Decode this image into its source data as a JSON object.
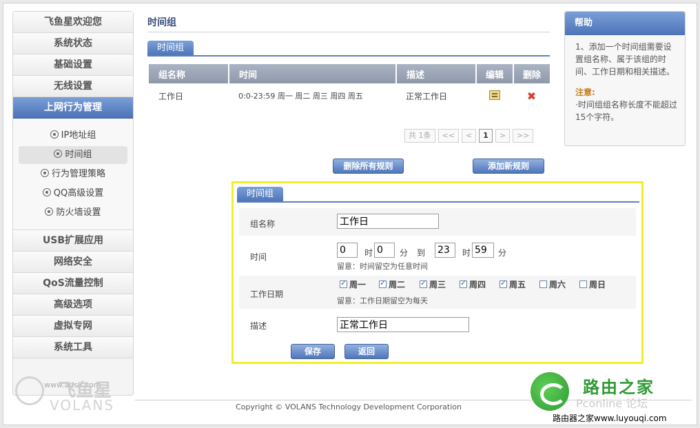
{
  "sidebar": {
    "items_top": [
      "飞鱼星欢迎您",
      "系统状态",
      "基础设置",
      "无线设置",
      "上网行为管理"
    ],
    "sub_items": [
      "IP地址组",
      "时间组",
      "行为管理策略",
      "QQ高级设置",
      "防火墙设置"
    ],
    "items_bottom": [
      "USB扩展应用",
      "网络安全",
      "QoS流量控制",
      "高级选项",
      "虚拟专网",
      "系统工具"
    ],
    "brand": {
      "zh": "飞鱼星",
      "en": "VOLANS",
      "url": "www.adslr.com"
    }
  },
  "page": {
    "title": "时间组",
    "list_tab": "时间组"
  },
  "table": {
    "headers": [
      "组名称",
      "时间",
      "描述",
      "编辑",
      "删除"
    ],
    "rows": [
      {
        "name": "工作日",
        "time": "0:0-23:59 周一 周二 周三 周四 周五",
        "desc": "正常工作日"
      }
    ],
    "icons": {
      "edit": "edit-icon",
      "delete": "delete-icon"
    }
  },
  "pager": {
    "total": "共 1条",
    "first": "<<",
    "prev": "<",
    "current": "1",
    "next": ">",
    "last": ">>"
  },
  "actions": {
    "delete_all": "删除所有规则",
    "add_new": "添加新规则"
  },
  "form": {
    "tab": "时间组",
    "name_label": "组名称",
    "name_value": "工作日",
    "time_label": "时间",
    "start_hour": "0",
    "start_min": "0",
    "end_hour": "23",
    "end_min": "59",
    "hour_unit": "时",
    "min_unit": "分",
    "to": "到",
    "time_hint": "留意：时间留空为任意时间",
    "days_label": "工作日期",
    "days": [
      {
        "label": "周一",
        "checked": true
      },
      {
        "label": "周二",
        "checked": true
      },
      {
        "label": "周三",
        "checked": true
      },
      {
        "label": "周四",
        "checked": true
      },
      {
        "label": "周五",
        "checked": true
      },
      {
        "label": "周六",
        "checked": false
      },
      {
        "label": "周日",
        "checked": false
      }
    ],
    "days_hint": "留意：工作日期留空为每天",
    "desc_label": "描述",
    "desc_value": "正常工作日",
    "save": "保存",
    "back": "返回"
  },
  "help": {
    "title": "帮助",
    "text": "1、添加一个时间组需要设置组名称、属于该组的时间、工作日期和相关描述。",
    "note_title": "注意:",
    "note_text": "·时间组组名称长度不能超过15个字符。"
  },
  "footer": {
    "copyright": "Copyright © VOLANS Technology Development Corporation"
  },
  "watermark": {
    "text": "路由之家",
    "faint": "Pconline 论坛",
    "url": "路由器之家www.luyouqi.com"
  },
  "colors": {
    "accent": "#4c73b9",
    "highlight_border": "#f2ef2a",
    "delete": "#d93a2a"
  }
}
